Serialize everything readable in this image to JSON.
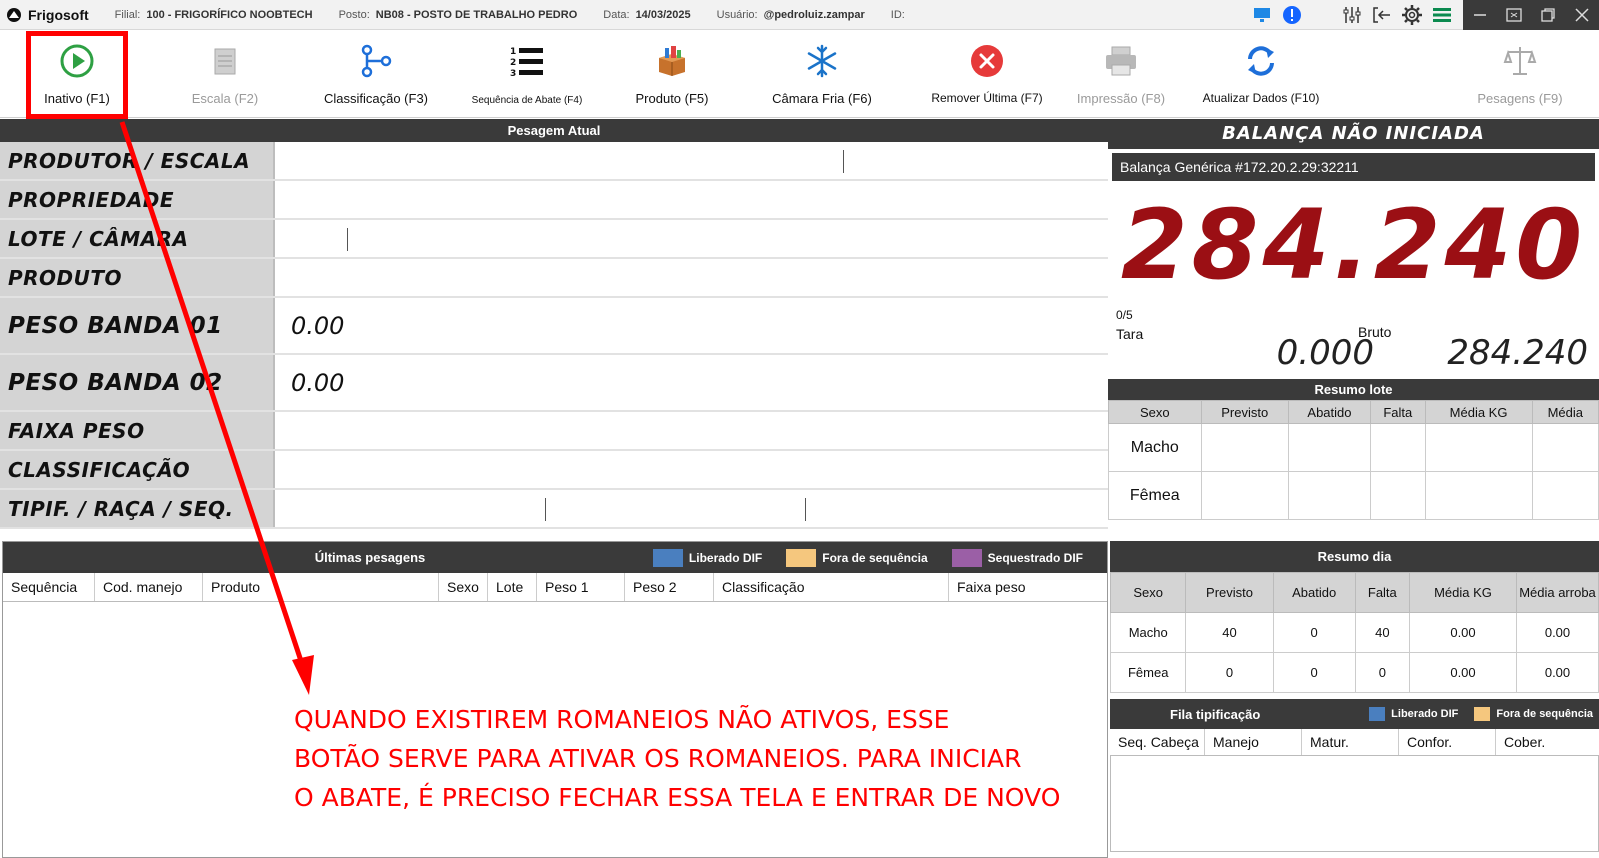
{
  "titlebar": {
    "app": "Frigosoft",
    "filial_label": "Filial:",
    "filial_value": "100 - FRIGORÍFICO NOOBTECH",
    "posto_label": "Posto:",
    "posto_value": "NB08 - POSTO DE TRABALHO PEDRO",
    "data_label": "Data:",
    "data_value": "14/03/2025",
    "usuario_label": "Usuário:",
    "usuario_value": "@pedroluiz.zampar",
    "id_label": "ID:"
  },
  "toolbar": {
    "inativo": "Inativo (F1)",
    "escala": "Escala (F2)",
    "classificacao": "Classificação (F3)",
    "sequencia": "Sequência de Abate (F4)",
    "produto": "Produto (F5)",
    "camara": "Câmara Fria (F6)",
    "remover": "Remover Última (F7)",
    "impressao": "Impressão (F8)",
    "atualizar": "Atualizar Dados (F10)",
    "pesagens": "Pesagens (F9)"
  },
  "pesagem": {
    "title": "Pesagem Atual",
    "produtor": "PRODUTOR / ESCALA",
    "propriedade": "PROPRIEDADE",
    "lote": "LOTE / CÂMARA",
    "produto": "PRODUTO",
    "banda1": "PESO BANDA 01",
    "banda1_val": "0.00",
    "banda2": "PESO BANDA 02",
    "banda2_val": "0.00",
    "faixa": "FAIXA PESO",
    "classificacao": "CLASSIFICAÇÃO",
    "tipif": "TIPIF. / RAÇA / SEQ."
  },
  "balanca": {
    "title": "BALANÇA NÃO INICIADA",
    "name": "Balança Genérica  #172.20.2.29:32211",
    "peso": "284.240",
    "count": "0/5",
    "tara_label": "Tara",
    "tara_value": "0.000",
    "bruto_label": "Bruto",
    "bruto_value": "284.240"
  },
  "resumo_lote": {
    "title": "Resumo lote",
    "headers": [
      "Sexo",
      "Previsto",
      "Abatido",
      "Falta",
      "Média KG",
      "Média"
    ],
    "macho": "Macho",
    "femea": "Fêmea"
  },
  "ultimas": {
    "title": "Últimas pesagens",
    "legend": [
      "Liberado DIF",
      "Fora de sequência",
      "Sequestrado DIF"
    ],
    "legend_colors": [
      "#4a7fbf",
      "#f5c77e",
      "#9b5fa6"
    ],
    "columns": [
      "Sequência",
      "Cod. manejo",
      "Produto",
      "Sexo",
      "Lote",
      "Peso 1",
      "Peso 2",
      "Classificação",
      "Faixa peso"
    ]
  },
  "resumo_dia": {
    "title": "Resumo dia",
    "headers": [
      "Sexo",
      "Previsto",
      "Abatido",
      "Falta",
      "Média KG",
      "Média arroba"
    ],
    "rows": [
      [
        "Macho",
        "40",
        "0",
        "40",
        "0.00",
        "0.00"
      ],
      [
        "Fêmea",
        "0",
        "0",
        "0",
        "0.00",
        "0.00"
      ]
    ]
  },
  "fila": {
    "title": "Fila tipificação",
    "legend": [
      "Liberado DIF",
      "Fora de sequência"
    ],
    "columns": [
      "Seq. Cabeça",
      "Manejo",
      "Matur.",
      "Confor.",
      "Cober."
    ]
  },
  "annotation": {
    "line1": "QUANDO EXISTIREM ROMANEIOS NÃO ATIVOS, ESSE",
    "line2": "BOTÃO SERVE PARA ATIVAR OS ROMANEIOS. PARA INICIAR",
    "line3": "O ABATE, É PRECISO FECHAR ESSA TELA E ENTRAR DE NOVO"
  }
}
